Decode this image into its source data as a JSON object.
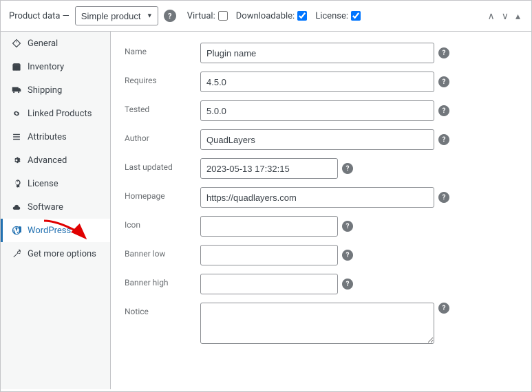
{
  "header": {
    "label": "Product data —",
    "product_type": "Simple product",
    "help_title": "?",
    "virtual_label": "Virtual:",
    "downloadable_label": "Downloadable:",
    "license_label": "License:"
  },
  "sidebar": {
    "items": [
      {
        "id": "general",
        "label": "General",
        "icon": "tag"
      },
      {
        "id": "inventory",
        "label": "Inventory",
        "icon": "box"
      },
      {
        "id": "shipping",
        "label": "Shipping",
        "icon": "truck"
      },
      {
        "id": "linked-products",
        "label": "Linked Products",
        "icon": "link"
      },
      {
        "id": "attributes",
        "label": "Attributes",
        "icon": "list"
      },
      {
        "id": "advanced",
        "label": "Advanced",
        "icon": "gear"
      },
      {
        "id": "license",
        "label": "License",
        "icon": "key"
      },
      {
        "id": "software",
        "label": "Software",
        "icon": "cloud"
      },
      {
        "id": "wordpress",
        "label": "WordPress",
        "icon": "wp"
      },
      {
        "id": "get-more-options",
        "label": "Get more options",
        "icon": "wrench"
      }
    ]
  },
  "form": {
    "name_label": "Name",
    "name_value": "Plugin name",
    "requires_label": "Requires",
    "requires_value": "4.5.0",
    "tested_label": "Tested",
    "tested_value": "5.0.0",
    "author_label": "Author",
    "author_value": "QuadLayers",
    "last_updated_label": "Last updated",
    "last_updated_value": "2023-05-13 17:32:15",
    "homepage_label": "Homepage",
    "homepage_value": "https://quadlayers.com",
    "icon_label": "Icon",
    "icon_value": "",
    "banner_low_label": "Banner low",
    "banner_low_value": "",
    "banner_high_label": "Banner high",
    "banner_high_value": "",
    "notice_label": "Notice",
    "notice_value": ""
  }
}
